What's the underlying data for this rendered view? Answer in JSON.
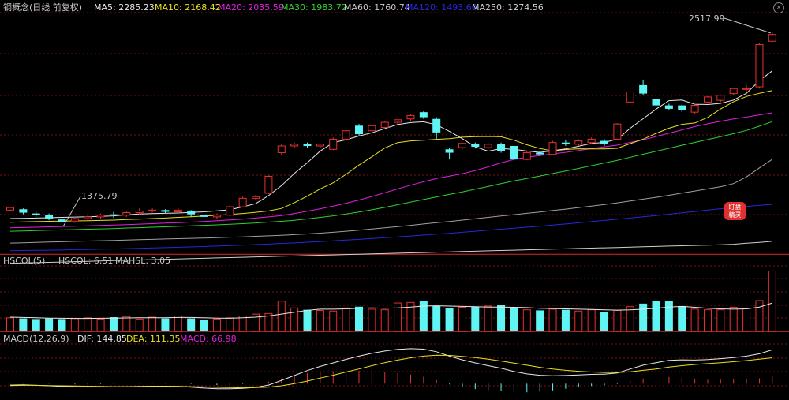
{
  "header": {
    "title": "钢概念(日线 前复权)",
    "ma5": "MA5: 2285.23",
    "ma10": "MA10: 2168.42",
    "ma20": "MA20: 2035.59",
    "ma30": "MA30: 1983.72",
    "ma60": "MA60: 1760.74",
    "ma120": "MA120: 1493.60",
    "ma250": "MA250: 1274.56",
    "close_icon": "close-icon"
  },
  "annotations": {
    "high": "2517.99",
    "low": "1375.79"
  },
  "badge": {
    "line1": "盯盘",
    "line2": "精灵"
  },
  "volume_panel": {
    "title": "HSCOL(5)",
    "hscol": "HSCOL: 6.51",
    "mahsl": "MAHSL: 3.05"
  },
  "macd_panel": {
    "title": "MACD(12,26,9)",
    "dif": "DIF: 144.85",
    "dea": "DEA: 111.35",
    "macd": "MACD: 66.98"
  },
  "colors": {
    "up": "#e83030",
    "down": "#5ff5f5",
    "ma5": "#e8e8e8",
    "ma10": "#e8e020",
    "ma20": "#e020e0",
    "ma30": "#30d030",
    "ma60": "#a0a0a0",
    "ma120": "#2828d8",
    "ma250": "#d0d0d0",
    "grid": "#7a1010"
  },
  "chart_data": {
    "type": "candlestick",
    "ylim": [
      1200,
      2620
    ],
    "candles": [
      [
        1460,
        1475,
        1455,
        1480
      ],
      [
        1465,
        1445,
        1435,
        1470
      ],
      [
        1440,
        1430,
        1420,
        1450
      ],
      [
        1430,
        1410,
        1400,
        1440
      ],
      [
        1405,
        1390,
        1376,
        1415
      ],
      [
        1395,
        1410,
        1385,
        1420
      ],
      [
        1410,
        1420,
        1400,
        1430
      ],
      [
        1420,
        1430,
        1410,
        1440
      ],
      [
        1435,
        1430,
        1415,
        1450
      ],
      [
        1430,
        1445,
        1420,
        1455
      ],
      [
        1445,
        1455,
        1435,
        1470
      ],
      [
        1455,
        1460,
        1445,
        1470
      ],
      [
        1460,
        1450,
        1440,
        1465
      ],
      [
        1450,
        1460,
        1440,
        1470
      ],
      [
        1455,
        1435,
        1420,
        1460
      ],
      [
        1430,
        1420,
        1410,
        1440
      ],
      [
        1420,
        1430,
        1410,
        1440
      ],
      [
        1430,
        1480,
        1425,
        1490
      ],
      [
        1480,
        1530,
        1475,
        1540
      ],
      [
        1530,
        1540,
        1520,
        1550
      ],
      [
        1560,
        1660,
        1555,
        1665
      ],
      [
        1800,
        1840,
        1790,
        1850
      ],
      [
        1840,
        1850,
        1830,
        1860
      ],
      [
        1850,
        1840,
        1830,
        1860
      ],
      [
        1840,
        1850,
        1830,
        1855
      ],
      [
        1820,
        1880,
        1815,
        1890
      ],
      [
        1880,
        1930,
        1870,
        1940
      ],
      [
        1960,
        1910,
        1900,
        1970
      ],
      [
        1930,
        1960,
        1920,
        1970
      ],
      [
        1950,
        1980,
        1940,
        1990
      ],
      [
        1980,
        1995,
        1970,
        2000
      ],
      [
        2000,
        2020,
        1990,
        2030
      ],
      [
        2040,
        2010,
        2000,
        2045
      ],
      [
        2000,
        1920,
        1880,
        2010
      ],
      [
        1820,
        1800,
        1760,
        1830
      ],
      [
        1830,
        1855,
        1820,
        1860
      ],
      [
        1850,
        1835,
        1825,
        1860
      ],
      [
        1830,
        1850,
        1820,
        1860
      ],
      [
        1850,
        1810,
        1800,
        1860
      ],
      [
        1840,
        1760,
        1750,
        1850
      ],
      [
        1760,
        1800,
        1755,
        1810
      ],
      [
        1800,
        1790,
        1780,
        1810
      ],
      [
        1790,
        1860,
        1785,
        1870
      ],
      [
        1860,
        1850,
        1840,
        1875
      ],
      [
        1850,
        1870,
        1840,
        1880
      ],
      [
        1860,
        1880,
        1850,
        1890
      ],
      [
        1870,
        1850,
        1840,
        1880
      ],
      [
        1880,
        1970,
        1875,
        1975
      ],
      [
        2100,
        2160,
        2095,
        2165
      ],
      [
        2200,
        2150,
        2140,
        2230
      ],
      [
        2120,
        2080,
        2070,
        2130
      ],
      [
        2080,
        2060,
        2050,
        2090
      ],
      [
        2080,
        2050,
        2040,
        2085
      ],
      [
        2040,
        2080,
        2030,
        2090
      ],
      [
        2100,
        2130,
        2090,
        2135
      ],
      [
        2110,
        2140,
        2100,
        2145
      ],
      [
        2150,
        2180,
        2140,
        2185
      ],
      [
        2175,
        2180,
        2165,
        2200
      ],
      [
        2190,
        2440,
        2180,
        2450
      ],
      [
        2460,
        2500,
        2455,
        2518
      ]
    ],
    "ma5": [
      1410,
      1411,
      1413,
      1415,
      1417,
      1419,
      1421,
      1423,
      1426,
      1432,
      1437,
      1439,
      1441,
      1443,
      1446,
      1450,
      1456,
      1462,
      1480,
      1498,
      1546,
      1605,
      1678,
      1741,
      1810,
      1860,
      1877,
      1899,
      1918,
      1943,
      1967,
      1978,
      1983,
      1965,
      1927,
      1883,
      1835,
      1809,
      1824,
      1820,
      1810,
      1802,
      1812,
      1822,
      1838,
      1855,
      1861,
      1880,
      1945,
      2001,
      2058,
      2108,
      2112,
      2087,
      2085,
      2092,
      2112,
      2152,
      2226,
      2285
    ],
    "ma10": [
      1388,
      1390,
      1392,
      1394,
      1395,
      1396,
      1397,
      1399,
      1401,
      1404,
      1407,
      1410,
      1413,
      1417,
      1421,
      1425,
      1429,
      1435,
      1440,
      1447,
      1455,
      1470,
      1504,
      1543,
      1586,
      1622,
      1672,
      1727,
      1776,
      1828,
      1860,
      1870,
      1874,
      1879,
      1883,
      1892,
      1895,
      1896,
      1894,
      1874,
      1847,
      1825,
      1810,
      1819,
      1823,
      1822,
      1822,
      1826,
      1854,
      1880,
      1914,
      1945,
      1968,
      1976,
      2009,
      2059,
      2102,
      2133,
      2152,
      2168
    ],
    "ma20": [
      1355,
      1357,
      1359,
      1361,
      1363,
      1365,
      1367,
      1369,
      1372,
      1374,
      1377,
      1380,
      1383,
      1386,
      1389,
      1393,
      1397,
      1402,
      1407,
      1413,
      1420,
      1428,
      1440,
      1453,
      1468,
      1484,
      1501,
      1520,
      1541,
      1563,
      1586,
      1608,
      1628,
      1647,
      1661,
      1676,
      1694,
      1716,
      1740,
      1760,
      1774,
      1783,
      1793,
      1802,
      1813,
      1824,
      1835,
      1845,
      1861,
      1876,
      1896,
      1915,
      1935,
      1955,
      1971,
      1986,
      2000,
      2011,
      2024,
      2036
    ],
    "ma30": [
      1335,
      1337,
      1339,
      1341,
      1343,
      1345,
      1347,
      1349,
      1351,
      1354,
      1356,
      1359,
      1361,
      1364,
      1367,
      1370,
      1373,
      1376,
      1380,
      1384,
      1389,
      1394,
      1400,
      1408,
      1417,
      1426,
      1437,
      1449,
      1462,
      1476,
      1492,
      1508,
      1523,
      1538,
      1553,
      1568,
      1584,
      1600,
      1617,
      1633,
      1647,
      1662,
      1677,
      1692,
      1707,
      1723,
      1739,
      1755,
      1773,
      1791,
      1808,
      1826,
      1844,
      1861,
      1878,
      1895,
      1913,
      1932,
      1957,
      1984
    ],
    "ma60": [
      1265,
      1267,
      1269,
      1271,
      1273,
      1275,
      1277,
      1279,
      1281,
      1283,
      1285,
      1287,
      1289,
      1291,
      1293,
      1295,
      1297,
      1300,
      1302,
      1305,
      1308,
      1311,
      1315,
      1319,
      1324,
      1329,
      1335,
      1341,
      1348,
      1355,
      1362,
      1370,
      1378,
      1386,
      1393,
      1401,
      1409,
      1417,
      1425,
      1433,
      1441,
      1449,
      1458,
      1466,
      1475,
      1484,
      1493,
      1503,
      1514,
      1525,
      1536,
      1548,
      1561,
      1573,
      1586,
      1599,
      1617,
      1657,
      1710,
      1761
    ],
    "ma120": [
      1220,
      1221,
      1222,
      1223,
      1224,
      1226,
      1227,
      1229,
      1230,
      1232,
      1234,
      1236,
      1238,
      1240,
      1242,
      1245,
      1247,
      1250,
      1253,
      1256,
      1259,
      1263,
      1266,
      1270,
      1274,
      1278,
      1283,
      1287,
      1292,
      1297,
      1302,
      1307,
      1312,
      1318,
      1323,
      1329,
      1335,
      1341,
      1347,
      1353,
      1359,
      1365,
      1372,
      1378,
      1385,
      1392,
      1399,
      1406,
      1413,
      1421,
      1428,
      1436,
      1444,
      1452,
      1460,
      1468,
      1476,
      1482,
      1488,
      1494
    ],
    "ma250": [
      1145,
      1147,
      1149,
      1151,
      1153,
      1155,
      1157,
      1159,
      1161,
      1163,
      1165,
      1167,
      1169,
      1171,
      1173,
      1175,
      1177,
      1179,
      1181,
      1183,
      1185,
      1187,
      1189,
      1191,
      1193,
      1195,
      1197,
      1199,
      1201,
      1203,
      1205,
      1207,
      1209,
      1211,
      1213,
      1215,
      1217,
      1219,
      1221,
      1223,
      1225,
      1227,
      1229,
      1231,
      1233,
      1235,
      1237,
      1239,
      1241,
      1243,
      1245,
      1247,
      1249,
      1251,
      1253,
      1255,
      1258,
      1264,
      1269,
      1275
    ],
    "volume": [
      2.2,
      2.1,
      2.0,
      2.1,
      2.0,
      2.1,
      2.2,
      2.0,
      2.3,
      2.4,
      2.0,
      2.3,
      2.1,
      2.5,
      2.1,
      1.9,
      2.0,
      2.2,
      2.5,
      2.8,
      2.9,
      4.9,
      3.8,
      3.5,
      3.4,
      3.3,
      3.8,
      4.0,
      3.6,
      3.5,
      4.6,
      4.7,
      4.9,
      4.1,
      3.8,
      3.9,
      4.0,
      4.1,
      4.3,
      3.8,
      3.5,
      3.4,
      3.6,
      3.5,
      3.3,
      3.5,
      3.2,
      3.4,
      4.0,
      4.5,
      4.9,
      4.9,
      4.1,
      3.6,
      3.5,
      3.5,
      3.9,
      3.7,
      5.0,
      9.8
    ],
    "vol_ylim": [
      0,
      10.5
    ],
    "hscol_ma": [
      2.3,
      2.25,
      2.2,
      2.15,
      2.12,
      2.1,
      2.1,
      2.12,
      2.15,
      2.18,
      2.2,
      2.2,
      2.22,
      2.25,
      2.25,
      2.2,
      2.15,
      2.12,
      2.2,
      2.3,
      2.5,
      2.8,
      3.1,
      3.4,
      3.6,
      3.6,
      3.65,
      3.75,
      3.8,
      3.75,
      3.8,
      3.95,
      4.1,
      4.15,
      4.1,
      4.05,
      4.0,
      3.95,
      3.95,
      3.9,
      3.85,
      3.75,
      3.7,
      3.65,
      3.6,
      3.55,
      3.5,
      3.45,
      3.5,
      3.6,
      3.75,
      3.95,
      4.05,
      3.9,
      3.75,
      3.65,
      3.6,
      3.65,
      3.95,
      4.6
    ],
    "dif": [
      -6,
      -5,
      -7,
      -9,
      -12,
      -13,
      -14,
      -14,
      -14,
      -13,
      -12,
      -11,
      -11,
      -12,
      -15,
      -19,
      -22,
      -22,
      -20,
      -16,
      -6,
      14,
      35,
      56,
      74,
      89,
      104,
      118,
      130,
      140,
      147,
      150,
      148,
      137,
      118,
      102,
      89,
      77,
      66,
      52,
      42,
      36,
      34,
      35,
      37,
      40,
      41,
      46,
      63,
      79,
      90,
      100,
      102,
      101,
      103,
      107,
      112,
      118,
      128,
      145
    ],
    "dea": [
      -8,
      -7,
      -7,
      -8,
      -9,
      -10,
      -11,
      -12,
      -13,
      -13,
      -13,
      -12,
      -12,
      -12,
      -13,
      -14,
      -16,
      -17,
      -18,
      -17,
      -15,
      -9,
      0,
      11,
      24,
      36,
      50,
      63,
      77,
      90,
      101,
      111,
      118,
      122,
      121,
      117,
      112,
      105,
      97,
      88,
      79,
      70,
      63,
      57,
      53,
      50,
      48,
      48,
      51,
      57,
      63,
      71,
      77,
      82,
      86,
      90,
      94,
      99,
      105,
      111
    ],
    "dif_ylim": [
      -70,
      170
    ]
  }
}
